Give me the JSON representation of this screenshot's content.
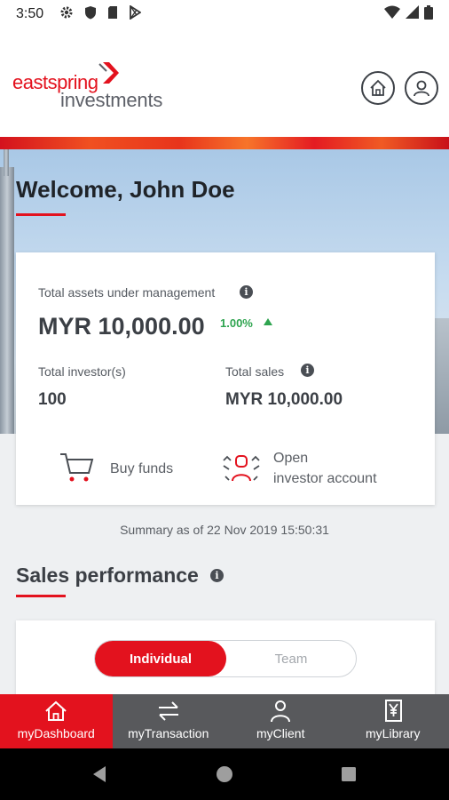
{
  "status_bar": {
    "time": "3:50"
  },
  "header": {
    "logo_word1": "eastspring",
    "logo_word2": "investments"
  },
  "hero": {
    "welcome": "Welcome, John Doe"
  },
  "summary": {
    "aum_label": "Total assets under management",
    "aum_value": "MYR 10,000.00",
    "aum_change": "1.00%",
    "investors_label": "Total investor(s)",
    "investors_value": "100",
    "sales_label": "Total sales",
    "sales_value": "MYR 10,000.00",
    "buy_funds": "Buy funds",
    "open_account_line1": "Open",
    "open_account_line2": "investor account"
  },
  "summary_date": "Summary as of 22 Nov 2019 15:50:31",
  "sales_performance": {
    "title": "Sales performance",
    "toggle": [
      "Individual",
      "Team"
    ]
  },
  "bottom_nav": [
    {
      "label": "myDashboard",
      "icon": "home-icon",
      "active": true
    },
    {
      "label": "myTransaction",
      "icon": "swap-arrows-icon",
      "active": false
    },
    {
      "label": "myClient",
      "icon": "person-icon",
      "active": false
    },
    {
      "label": "myLibrary",
      "icon": "yen-book-icon",
      "active": false
    }
  ],
  "colors": {
    "brand_red": "#e3121e",
    "positive_green": "#2ea44f",
    "nav_grey": "#58595c"
  }
}
